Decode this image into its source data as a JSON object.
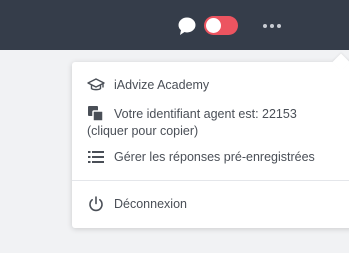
{
  "topbar": {
    "chat_icon": "chat-bubble-icon",
    "availability_toggle": {
      "state": "off",
      "color": "#ec5460"
    },
    "more_icon": "more-horizontal-icon"
  },
  "menu": {
    "items": [
      {
        "icon": "graduation-cap-icon",
        "label": "iAdvize Academy"
      },
      {
        "icon": "copy-icon",
        "label": "Votre identifiant agent est: 22153",
        "label2": "(cliquer pour copier)"
      },
      {
        "icon": "list-icon",
        "label": "Gérer les réponses pré-enregistrées"
      },
      {
        "icon": "power-icon",
        "label": "Déconnexion"
      }
    ]
  },
  "colors": {
    "topbar": "#353d4a",
    "background": "#f1f2f4",
    "text": "#4a4f57",
    "toggle_off": "#ec5460"
  }
}
